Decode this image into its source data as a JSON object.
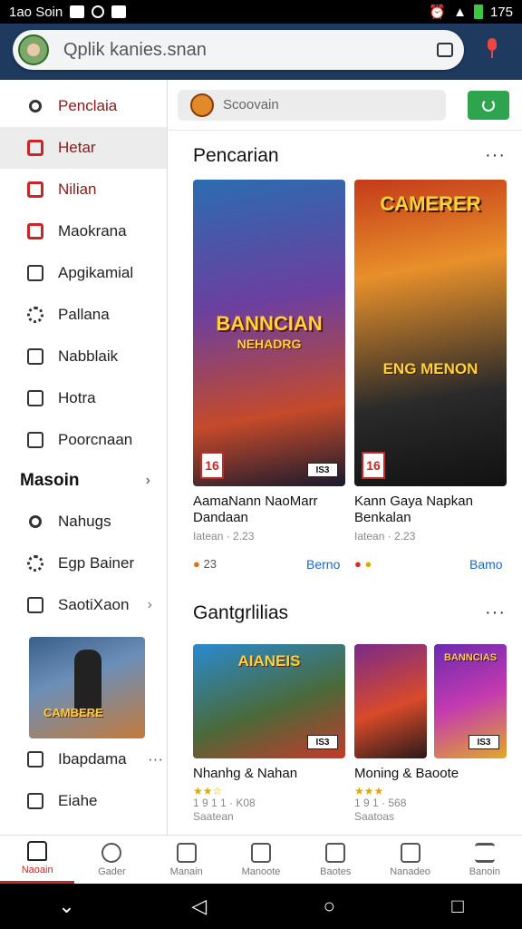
{
  "status_bar": {
    "left_text": "1ao Soin",
    "time": "175"
  },
  "search": {
    "text": "Qplik kanies.snan"
  },
  "sidebar": {
    "items": [
      {
        "label": "Penclaia"
      },
      {
        "label": "Hetar"
      },
      {
        "label": "Nilian"
      },
      {
        "label": "Maokrana"
      },
      {
        "label": "Apgikamial"
      },
      {
        "label": "Pallana"
      },
      {
        "label": "Nabblaik"
      },
      {
        "label": "Hotra"
      },
      {
        "label": "Poorcnaan"
      }
    ],
    "section_head": "Masoin",
    "section_items": [
      {
        "label": "Nahugs"
      },
      {
        "label": "Egp Bainer"
      },
      {
        "label": "SaotiXaon"
      }
    ],
    "promo_text": "CAMBERE",
    "extra_items": [
      {
        "label": "Ibapdama"
      },
      {
        "label": "Eiahe"
      }
    ]
  },
  "main": {
    "sub_search": "Scoovain",
    "section1": {
      "title": "Pencarian",
      "more": "···",
      "cards": [
        {
          "art_title": "BANNCIAN",
          "art_sub": "NEHADRG",
          "age": "16",
          "badge": "IS3",
          "title": "AamaNann NaoMarr Dandaan",
          "meta": "Iatean · 2.23",
          "rating": "23",
          "link": "Berno"
        },
        {
          "art_title": "CAMERER",
          "art_sub": "ENG MENON",
          "age": "16",
          "title": "Kann Gaya Napkan Benkalan",
          "meta": "Iatean · 2.23",
          "link": "Bamo"
        }
      ]
    },
    "section2": {
      "title": "Gantgrlilias",
      "more": "···",
      "cards": [
        {
          "art_title": "AIANEIS",
          "badge": "IS3",
          "title": "Nhanhg & Nahan",
          "stars": "★★☆",
          "meta": "1 9 1 1 · K08",
          "sub": "Saatean"
        },
        {
          "art_title": "BANNCIAS",
          "badge": "IS3",
          "title": "Moning & Baoote",
          "stars": "★★★",
          "meta": "1 9 1 · 568",
          "sub": "Saatoas"
        }
      ]
    }
  },
  "bottom_nav": [
    {
      "label": "Naoain"
    },
    {
      "label": "Gader"
    },
    {
      "label": "Manain"
    },
    {
      "label": "Manoote"
    },
    {
      "label": "Baotes"
    },
    {
      "label": "Nanadeo"
    },
    {
      "label": "Banoin"
    }
  ],
  "colors": {
    "accent": "#c62828",
    "topbar": "#1e3a5f",
    "link": "#1e66c5",
    "green": "#2ea44f"
  }
}
